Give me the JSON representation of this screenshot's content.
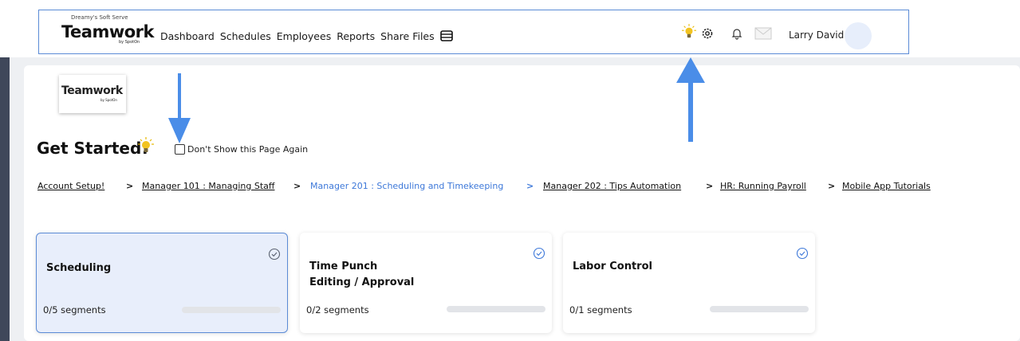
{
  "header": {
    "company": "Dreamy's Soft Serve",
    "logo": "Teamwork",
    "logo_by": "by SpotOn",
    "nav": [
      "Dashboard",
      "Schedules",
      "Employees",
      "Reports",
      "Share Files"
    ],
    "icons": [
      "book-icon",
      "lightbulb-icon",
      "gear-icon",
      "bell-icon",
      "mail-icon"
    ],
    "user_name": "Larry David"
  },
  "page": {
    "logo": "Teamwork",
    "logo_by": "by SpotOn",
    "title": "Get Started!",
    "dont_show": "Don't Show this Page Again",
    "dont_show_checked": false
  },
  "steps": [
    {
      "label": "Account Setup!",
      "active": false
    },
    {
      "label": "Manager 101 : Managing Staff",
      "active": false
    },
    {
      "label": "Manager 201 : Scheduling and Timekeeping",
      "active": true
    },
    {
      "label": "Manager 202 : Tips Automation",
      "active": false
    },
    {
      "label": "HR: Running Payroll",
      "active": false
    },
    {
      "label": "Mobile App Tutorials",
      "active": false
    }
  ],
  "step_separator": ">",
  "cards": [
    {
      "title": "Scheduling",
      "title2": "",
      "segments": "0/5 segments",
      "progress": 0,
      "selected": true
    },
    {
      "title": "Time Punch",
      "title2": "Editing / Approval",
      "segments": "0/2 segments",
      "progress": 0,
      "selected": false
    },
    {
      "title": "Labor Control",
      "title2": "",
      "segments": "0/1 segments",
      "progress": 0,
      "selected": false
    }
  ],
  "colors": {
    "accent": "#3d78d9",
    "arrow": "#4a8de8",
    "bulb": "#f2c31f",
    "sidebar": "#3f475a"
  }
}
